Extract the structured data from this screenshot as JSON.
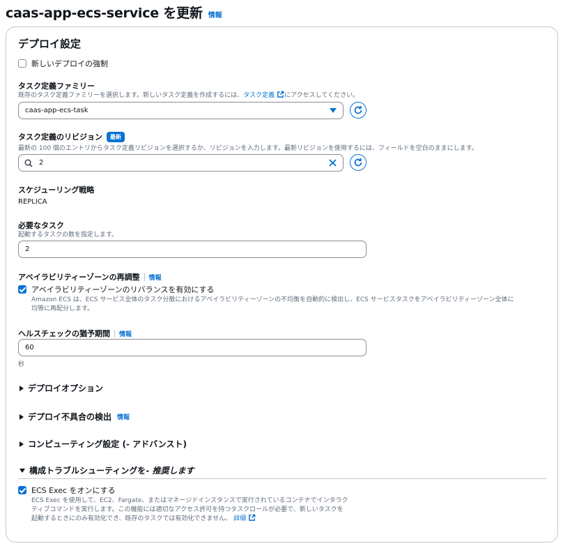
{
  "header": {
    "title": "caas-app-ecs-service を更新",
    "info": "情報"
  },
  "deploy": {
    "section_title": "デプロイ設定",
    "force_label": "新しいデプロイの強制",
    "family_label": "タスク定義ファミリー",
    "family_desc_pre": "既存のタスク定義ファミリーを選択します。新しいタスク定義を作成するには、",
    "family_desc_link": "タスク定義",
    "family_desc_post": " にアクセスしてください。",
    "family_value": "caas-app-ecs-task",
    "revision_label": "タスク定義のリビジョン",
    "revision_badge": "最新",
    "revision_desc": "最新の 100 個のエントリからタスク定義リビジョンを選択するか、リビジョンを入力します。最新リビジョンを使用するには、フィールドを空白のままにします。",
    "revision_value": "2",
    "strategy_label": "スケジューリング戦略",
    "strategy_value": "REPLICA",
    "tasks_label": "必要なタスク",
    "tasks_desc": "起動するタスクの数を指定します。",
    "tasks_value": "2",
    "az_label": "アベイラビリティーゾーンの再調整",
    "az_info": "情報",
    "az_check_label": "アベイラビリティーゾーンのリバランスを有効にする",
    "az_check_desc_1": "Amazon ECS は、ECS サービス全体のタスク分散におけるアベイラビリティーゾーンの不均衡を自動的に検出し、ECS サービスタスクをアベイラビリティーゾーン全体に",
    "az_check_desc_2": "均等に再配分します。",
    "grace_label": "ヘルスチェックの猶予期間",
    "grace_info": "情報",
    "grace_value": "60",
    "grace_unit": "秒"
  },
  "expanders": {
    "deploy_options": "デプロイオプション",
    "failure_detect": "デプロイ不具合の検出",
    "failure_info": "情報",
    "compute": "コンピューティング設定 (- アドバンスト)",
    "troubleshoot_prefix": "構成トラブルシューティングを- ",
    "troubleshoot_suffix": "推奨します"
  },
  "exec": {
    "label": "ECS Exec をオンにする",
    "desc_1": "ECS Exec を使用して、EC2、Fargate、またはマネージドインスタンスで実行されているコンテナでインタラク",
    "desc_2": "ティブコマンドを実行します。この機能には適切なアクセス許可を持つタスクロールが必要で、新しいタスクを",
    "desc_3": "起動するときにのみ有効化でき、既存のタスクでは有効化できません。",
    "link": "詳細"
  }
}
